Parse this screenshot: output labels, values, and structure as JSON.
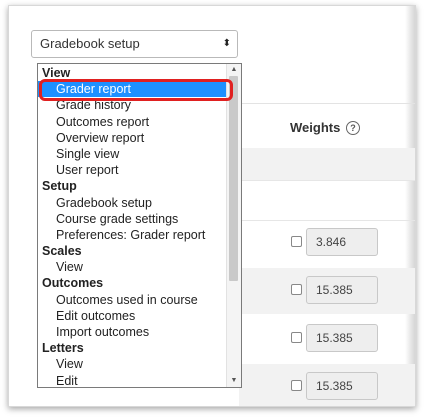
{
  "select": {
    "value": "Gradebook setup",
    "arrows": "⬍"
  },
  "table": {
    "weights_header": "Weights",
    "help_icon": "?",
    "weights": [
      "3.846",
      "15.385",
      "15.385",
      "15.385"
    ]
  },
  "dropdown": {
    "items": [
      {
        "label": "View",
        "type": "group"
      },
      {
        "label": "Grader report",
        "type": "option",
        "selected": true
      },
      {
        "label": "Grade history",
        "type": "option"
      },
      {
        "label": "Outcomes report",
        "type": "option"
      },
      {
        "label": "Overview report",
        "type": "option"
      },
      {
        "label": "Single view",
        "type": "option"
      },
      {
        "label": "User report",
        "type": "option"
      },
      {
        "label": "Setup",
        "type": "group"
      },
      {
        "label": "Gradebook setup",
        "type": "option"
      },
      {
        "label": "Course grade settings",
        "type": "option"
      },
      {
        "label": "Preferences: Grader report",
        "type": "option"
      },
      {
        "label": "Scales",
        "type": "group"
      },
      {
        "label": "View",
        "type": "option"
      },
      {
        "label": "Outcomes",
        "type": "group"
      },
      {
        "label": "Outcomes used in course",
        "type": "option"
      },
      {
        "label": "Edit outcomes",
        "type": "option"
      },
      {
        "label": "Import outcomes",
        "type": "option"
      },
      {
        "label": "Letters",
        "type": "group"
      },
      {
        "label": "View",
        "type": "option"
      },
      {
        "label": "Edit",
        "type": "option"
      }
    ],
    "scroll_up": "▲",
    "scroll_down": "▼"
  },
  "colors": {
    "selected": "#1e90ff",
    "highlight": "#e02020"
  }
}
